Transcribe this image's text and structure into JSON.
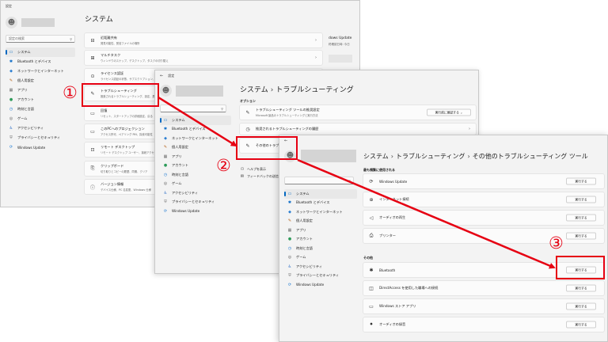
{
  "window1": {
    "title": "設定",
    "search_placeholder": "設定の検索",
    "page_title": "システム",
    "nav": [
      {
        "icon": "▭",
        "label": "システム",
        "active": true,
        "color": "#0067c0"
      },
      {
        "icon": "✱",
        "label": "Bluetooth とデバイス",
        "color": "#0a6ac6"
      },
      {
        "icon": "◆",
        "label": "ネットワークとインターネット",
        "color": "#2d7fd1"
      },
      {
        "icon": "✎",
        "label": "個人用設定",
        "color": "#b5651d"
      },
      {
        "icon": "▦",
        "label": "アプリ",
        "color": "#6a6a6a"
      },
      {
        "icon": "●",
        "label": "アカウント",
        "color": "#2d9b59"
      },
      {
        "icon": "◷",
        "label": "時刻と言語",
        "color": "#1f7ad1"
      },
      {
        "icon": "◎",
        "label": "ゲーム",
        "color": "#555555"
      },
      {
        "icon": "♿",
        "label": "アクセシビリティ",
        "color": "#2e6fc7"
      },
      {
        "icon": "⛨",
        "label": "プライバシーとセキュリティ",
        "color": "#777777"
      },
      {
        "icon": "⟳",
        "label": "Windows Update",
        "color": "#1f7ad1"
      }
    ],
    "cards": [
      {
        "icon": "⊟",
        "title": "近距離共有",
        "sub": "発見可能性、受信ファイルの場所"
      },
      {
        "icon": "⊞",
        "title": "マルチタスク",
        "sub": "ウィンドウのスナップ、デスクトップ、タスクの切り替え"
      },
      {
        "icon": "⊙",
        "title": "ライセンス認証",
        "sub": "ライセンス認証の状態、サブスクリプション、プロダクト キー"
      },
      {
        "icon": "✎",
        "title": "トラブルシューティング",
        "sub": "推奨されるトラブルシューティング、設定、履歴"
      },
      {
        "icon": "▭",
        "title": "回復",
        "sub": "リセット、スタートアップの詳細設定、戻る"
      },
      {
        "icon": "▭",
        "title": "このPCへのプロジェクション",
        "sub": "アクセス許可、ペアリング PIN、探索可能性"
      },
      {
        "icon": "⊡",
        "title": "リモート デスクトップ",
        "sub": "リモート デスクトップ ユーザー、接続アクセス許可"
      },
      {
        "icon": "⎘",
        "title": "クリップボード",
        "sub": "切り取りとコピーの履歴、同期、クリア"
      },
      {
        "icon": "ⓘ",
        "title": "バージョン情報",
        "sub": "デバイス仕様、PC 名変更、Windows 仕様"
      }
    ],
    "right_partial": {
      "title": "dows Update",
      "sub": "終確認日時: 今日"
    }
  },
  "window2": {
    "title": "設定",
    "page_title": [
      "システム",
      "トラブルシューティング"
    ],
    "section_label": "オプション",
    "cards": [
      {
        "icon": "✎",
        "title": "トラブルシューティング ツールの推奨設定",
        "sub": "Microsoft 製品のトラブルシューティングと実行方法",
        "dropdown": "実行前に確認する"
      },
      {
        "icon": "◷",
        "title": "推奨されるトラブルシューティングの履歴"
      },
      {
        "icon": "✎",
        "title": "その他のトラブルシ"
      }
    ],
    "links": [
      {
        "icon": "⚇",
        "label": "ヘルプを表示"
      },
      {
        "icon": "✉",
        "label": "フィードバックの送信"
      }
    ]
  },
  "window3": {
    "title": "",
    "page_title": [
      "システム",
      "トラブルシューティング",
      "その他のトラブルシューティング ツール"
    ],
    "section_frequent": "最も頻繁に使用される",
    "section_other": "その他",
    "run_label": "実行する",
    "frequent": [
      {
        "icon": "⟳",
        "title": "Windows Update"
      },
      {
        "icon": "⊕",
        "title": "インターネット接続"
      },
      {
        "icon": "◁",
        "title": "オーディオの再生"
      },
      {
        "icon": "⎙",
        "title": "プリンター"
      }
    ],
    "other": [
      {
        "icon": "✱",
        "title": "Bluetooth"
      },
      {
        "icon": "◫",
        "title": "DirectAccess を使用した職場への接続"
      },
      {
        "icon": "▭",
        "title": "Windows ストア アプリ"
      },
      {
        "icon": "⏺",
        "title": "オーディオの録音"
      }
    ]
  },
  "callouts": [
    "①",
    "②",
    "③"
  ],
  "accent": "#e60012"
}
